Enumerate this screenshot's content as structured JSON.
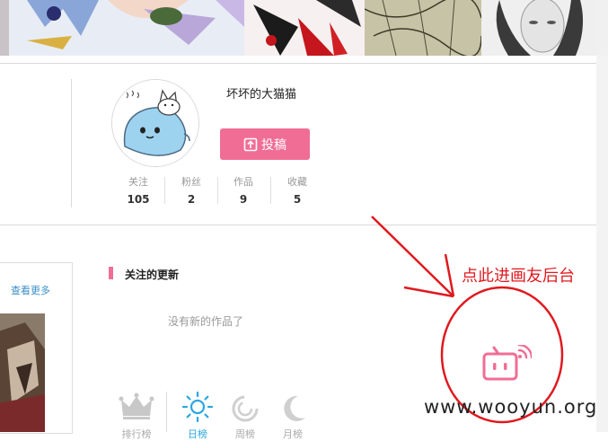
{
  "profile": {
    "username": "坏坏的大猫猫",
    "upload_label": "投稿",
    "stats": [
      {
        "label": "关注",
        "value": "105"
      },
      {
        "label": "粉丝",
        "value": "2"
      },
      {
        "label": "作品",
        "value": "9"
      },
      {
        "label": "收藏",
        "value": "5"
      }
    ]
  },
  "sidebar": {
    "more_label": "查看更多"
  },
  "feed": {
    "title": "关注的更新",
    "empty_text": "没有新的作品了"
  },
  "nav": {
    "items": [
      {
        "label": "排行榜",
        "icon": "crown-icon"
      },
      {
        "label": "日榜",
        "icon": "sun-icon"
      },
      {
        "label": "周榜",
        "icon": "circle-icon"
      },
      {
        "label": "月榜",
        "icon": "moon-icon"
      }
    ]
  },
  "annotation": {
    "text": "点此进画友后台"
  },
  "watermark": {
    "text": "www.wooyun.org"
  },
  "colors": {
    "accent": "#f06e95",
    "annotation": "#e0191e",
    "link": "#3a8ec8"
  }
}
